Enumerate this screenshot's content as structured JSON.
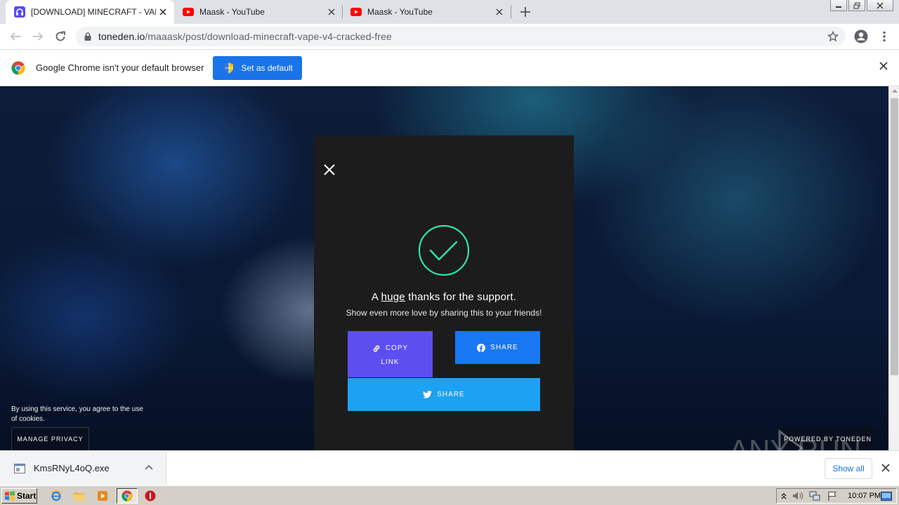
{
  "tabs": [
    {
      "title": "[DOWNLOAD] MINECRAFT - VAPE V",
      "favicon": "toneden-icon",
      "active": true
    },
    {
      "title": "Maask - YouTube",
      "favicon": "youtube-icon",
      "active": false
    },
    {
      "title": "Maask - YouTube",
      "favicon": "youtube-icon",
      "active": false
    }
  ],
  "address_bar": {
    "host": "toneden.io",
    "path": "/maaask/post/download-minecraft-vape-v4-cracked-free"
  },
  "infobar": {
    "message": "Google Chrome isn't your default browser",
    "button_label": "Set as default"
  },
  "modal": {
    "thanks_prefix": "A ",
    "thanks_emphasis": "huge",
    "thanks_suffix": " thanks for the support.",
    "subtitle": "Show even more love by sharing this to your friends!",
    "copy_label_line1": "COPY",
    "copy_label_line2": "LINK",
    "facebook_label": "SHARE",
    "twitter_label": "SHARE"
  },
  "cookie_notice": {
    "text": "By using this service, you agree to the use of cookies.",
    "button_label": "MANAGE PRIVACY"
  },
  "powered_by": "POWERED BY TONEDEN",
  "watermark": "ANY RUN",
  "download_shelf": {
    "filename": "KmsRNyL4oQ.exe",
    "show_all_label": "Show all"
  },
  "taskbar": {
    "start_label": "Start",
    "time": "10:07 PM"
  },
  "colors": {
    "copy_button": "#5d4ef0",
    "facebook_button": "#1877f2",
    "twitter_button": "#1da1f2",
    "check_green": "#2ee6a6",
    "chrome_blue": "#1a73e8"
  }
}
